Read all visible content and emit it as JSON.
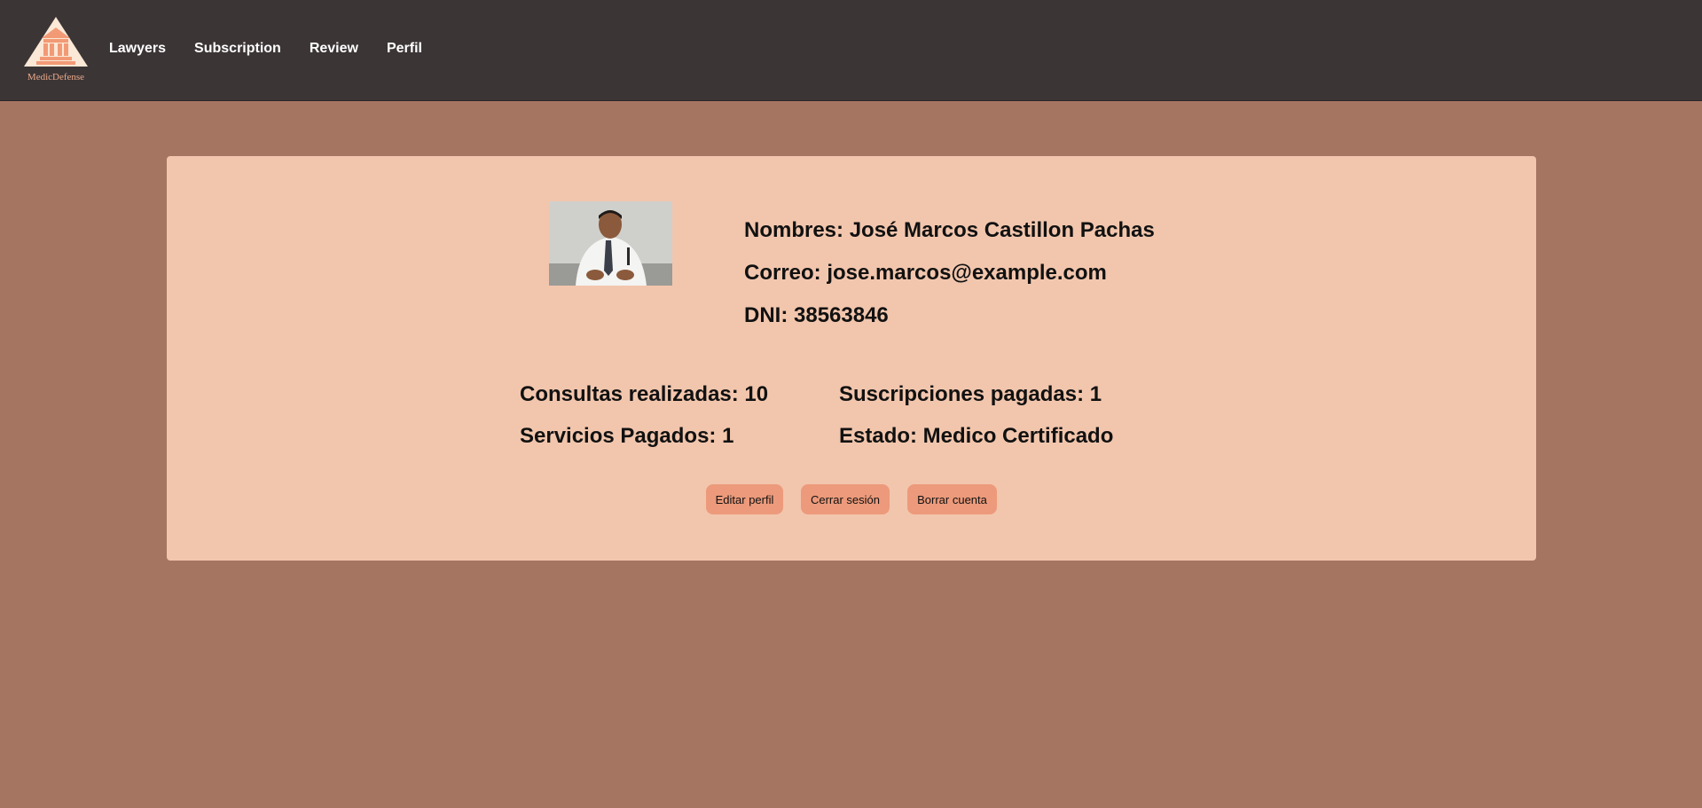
{
  "header": {
    "brand": "MedicDefense",
    "nav": [
      {
        "label": "Lawyers"
      },
      {
        "label": "Subscription"
      },
      {
        "label": "Review"
      },
      {
        "label": "Perfil"
      }
    ]
  },
  "profile": {
    "name_line": "Nombres: José Marcos Castillon Pachas",
    "email_line": "Correo: jose.marcos@example.com",
    "dni_line": "DNI: 38563846",
    "photo_alt": "Foto de perfil"
  },
  "stats": {
    "consultas": "Consultas realizadas: 10",
    "suscripciones": "Suscripciones pagadas: 1",
    "servicios": "Servicios Pagados: 1",
    "estado": "Estado: Medico Certificado"
  },
  "actions": {
    "edit": "Editar perfil",
    "logout": "Cerrar sesión",
    "delete": "Borrar cuenta"
  },
  "colors": {
    "header_bg": "#3c3536",
    "page_bg": "#a67562",
    "card_bg": "#f2c6ad",
    "button_bg": "#ec9a7b"
  }
}
